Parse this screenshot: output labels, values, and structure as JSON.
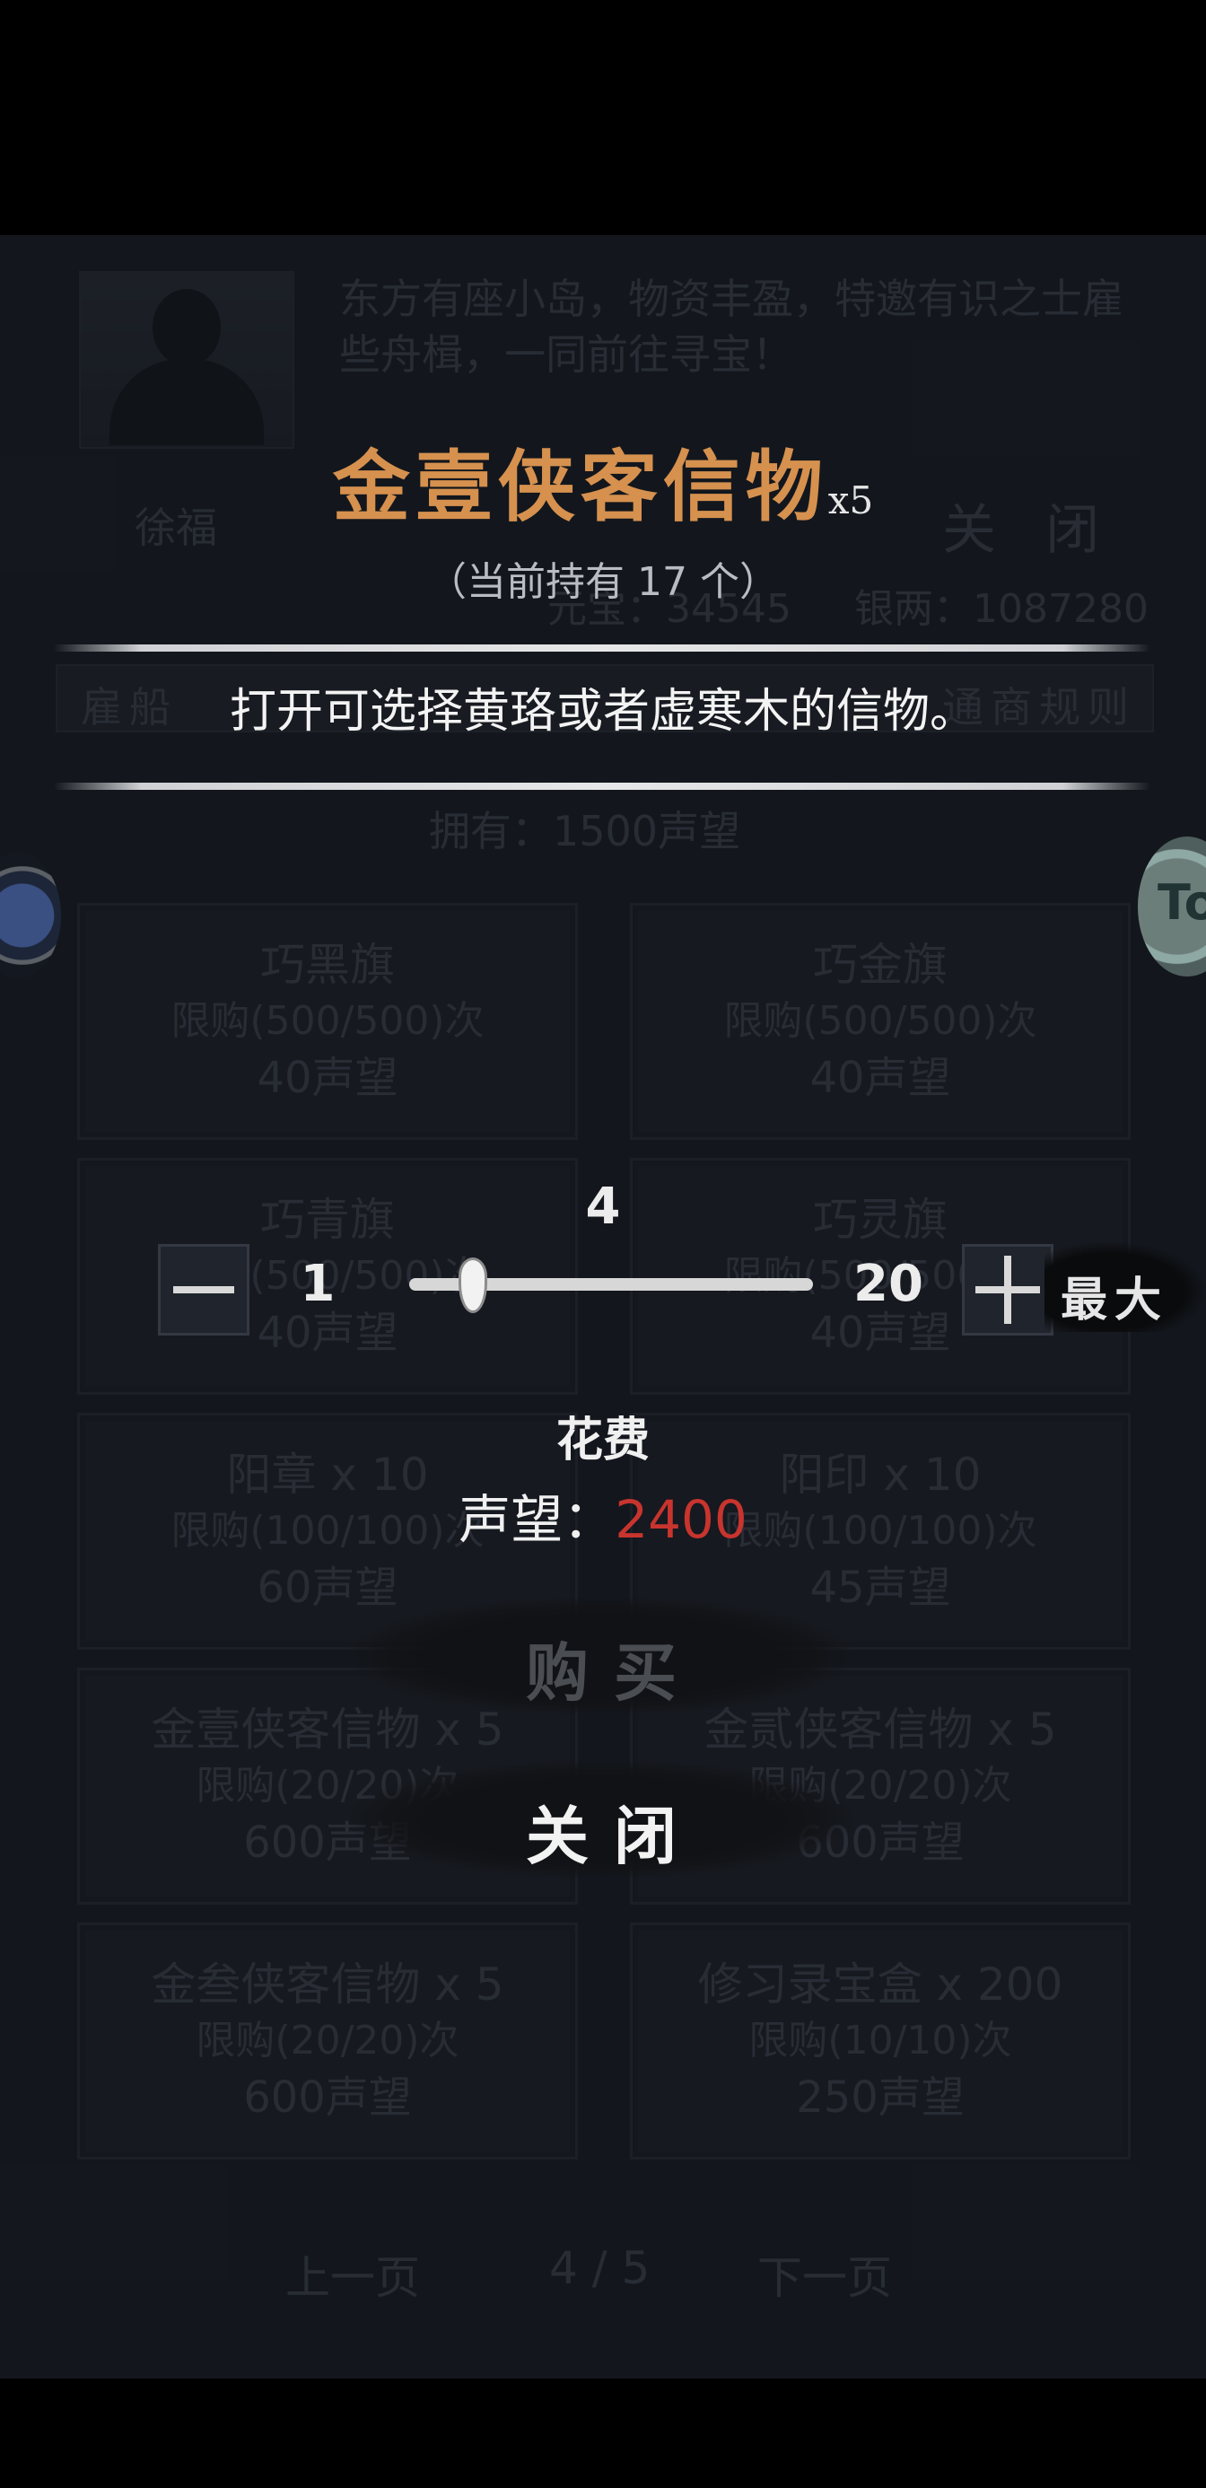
{
  "background_shop": {
    "npc_name": "徐福",
    "npc_description": "东方有座小岛，物资丰盈，特邀有识之士雇些舟楫，一同前往寻宝！",
    "close_label": "关 闭",
    "stats": {
      "left": "元宝：34545",
      "right": "银两：1087280"
    },
    "tabs": {
      "left": "雇船",
      "right": "通商规则"
    },
    "owned": "拥有：1500声望",
    "items": [
      {
        "name": "巧黑旗",
        "limit": "限购(500/500)次",
        "cost": "40声望"
      },
      {
        "name": "巧金旗",
        "limit": "限购(500/500)次",
        "cost": "40声望"
      },
      {
        "name": "巧青旗",
        "limit": "限购(500/500)次",
        "cost": "40声望"
      },
      {
        "name": "巧灵旗",
        "limit": "限购(500/500)次",
        "cost": "40声望"
      },
      {
        "name": "阳章 x 10",
        "limit": "限购(100/100)次",
        "cost": "60声望"
      },
      {
        "name": "阳印 x 10",
        "limit": "限购(100/100)次",
        "cost": "45声望"
      },
      {
        "name": "金壹侠客信物 x 5",
        "limit": "限购(20/20)次",
        "cost": "600声望"
      },
      {
        "name": "金贰侠客信物 x 5",
        "limit": "限购(20/20)次",
        "cost": "600声望"
      },
      {
        "name": "金叁侠客信物 x 5",
        "limit": "限购(20/20)次",
        "cost": "600声望"
      },
      {
        "name": "修习录宝盒 x 200",
        "limit": "限购(10/10)次",
        "cost": "250声望"
      }
    ],
    "pager": {
      "prev": "上一页",
      "page": "4 / 5",
      "next": "下一页"
    }
  },
  "side_buttons": {
    "right_badge": "To"
  },
  "dialog": {
    "title": "金壹侠客信物",
    "title_qty": "x5",
    "held": "（当前持有 17 个）",
    "description": "打开可选择黄珞或者虚寒木的信物。",
    "quantity": {
      "current": "4",
      "min": "1",
      "max": "20",
      "fraction": 0.158,
      "max_button": "最大"
    },
    "cost_heading": "花费",
    "cost_label": "声望：",
    "cost_value": "2400",
    "buy_label": "购买",
    "close_label": "关闭"
  },
  "colors": {
    "title": "#d6914f",
    "cost_value": "#c8342e",
    "panel": "#1b1f27"
  }
}
